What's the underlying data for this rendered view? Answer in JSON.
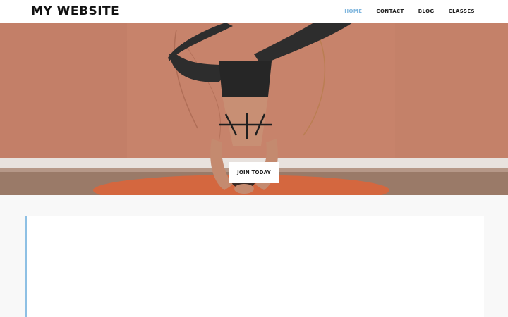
{
  "header": {
    "logo": "MY WEBSITE",
    "nav": [
      {
        "label": "HOME",
        "active": true
      },
      {
        "label": "CONTACT",
        "active": false
      },
      {
        "label": "BLOG",
        "active": false
      },
      {
        "label": "CLASSES",
        "active": false
      }
    ]
  },
  "hero": {
    "cta_label": "JOIN TODAY"
  },
  "colors": {
    "accent": "#7fb6de",
    "card_accent": "#8ec0e4",
    "hero_wall": "#c98770",
    "mat": "#d4673f"
  }
}
